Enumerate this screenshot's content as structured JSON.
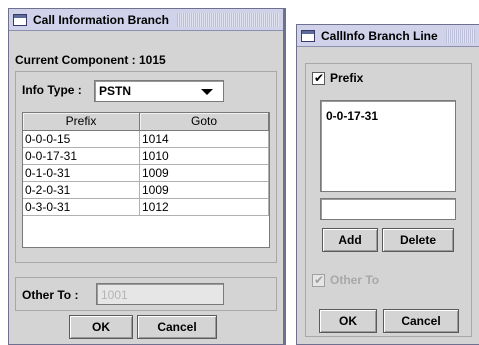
{
  "window1": {
    "title": "Call Information Branch",
    "current_component": {
      "label": "Current Component :",
      "value": "1015"
    },
    "info_type": {
      "label": "Info Type :",
      "selected": "PSTN"
    },
    "table": {
      "columns": [
        "Prefix",
        "Goto"
      ],
      "rows": [
        [
          "0-0-0-15",
          "1014"
        ],
        [
          "0-0-17-31",
          "1010"
        ],
        [
          "0-1-0-31",
          "1009"
        ],
        [
          "0-2-0-31",
          "1009"
        ],
        [
          "0-3-0-31",
          "1012"
        ]
      ]
    },
    "other_to": {
      "label": "Other To :",
      "placeholder": "1001"
    },
    "buttons": {
      "ok": "OK",
      "cancel": "Cancel"
    }
  },
  "window2": {
    "title": "CallInfo Branch Line",
    "prefix_checkbox": {
      "label": "Prefix",
      "checked": true
    },
    "prefix_list": [
      "0-0-17-31"
    ],
    "entry_value": "",
    "buttons": {
      "add": "Add",
      "delete": "Delete",
      "ok": "OK",
      "cancel": "Cancel"
    },
    "other_to_checkbox": {
      "label": "Other To",
      "checked": true,
      "enabled": false
    }
  }
}
